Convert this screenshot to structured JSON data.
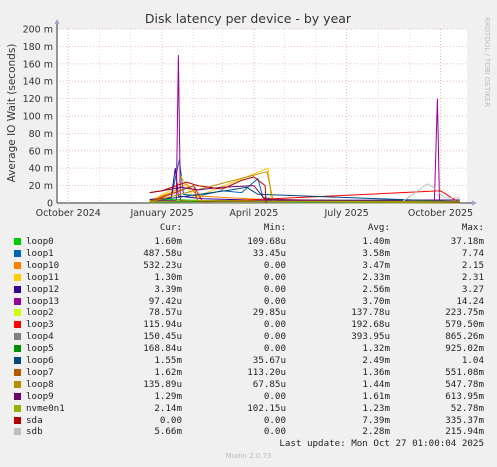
{
  "chart_data": {
    "type": "line",
    "title": "Disk latency per device - by year",
    "ylabel": "Average IO Wait (seconds)",
    "watermark": "RRDTOOL / TOBI OETIKER",
    "ylim": [
      0,
      0.2
    ],
    "y_ticks": [
      {
        "value": 0,
        "label": "0"
      },
      {
        "value": 0.02,
        "label": "20 m"
      },
      {
        "value": 0.04,
        "label": "40 m"
      },
      {
        "value": 0.06,
        "label": "60 m"
      },
      {
        "value": 0.08,
        "label": "80 m"
      },
      {
        "value": 0.1,
        "label": "100 m"
      },
      {
        "value": 0.12,
        "label": "120 m"
      },
      {
        "value": 0.14,
        "label": "140 m"
      },
      {
        "value": 0.16,
        "label": "160 m"
      },
      {
        "value": 0.18,
        "label": "180 m"
      },
      {
        "value": 0.2,
        "label": "200 m"
      }
    ],
    "xlim": [
      "2024-09-20",
      "2025-10-27"
    ],
    "x_ticks": [
      {
        "date": "2024-10-01",
        "label": "October 2024"
      },
      {
        "date": "2025-01-01",
        "label": "January 2025"
      },
      {
        "date": "2025-04-01",
        "label": "April 2025"
      },
      {
        "date": "2025-07-01",
        "label": "July 2025"
      },
      {
        "date": "2025-10-01",
        "label": "October 2025"
      }
    ],
    "legend_headers": {
      "cur": "Cur:",
      "min": "Min:",
      "avg": "Avg:",
      "max": "Max:"
    },
    "series": [
      {
        "name": "loop0",
        "color": "#00cc00",
        "cur": "1.60m",
        "min": "109.68u",
        "avg": "1.40m",
        "max": "37.18m",
        "points": [
          [
            "2024-12-20",
            0.002
          ],
          [
            "2025-01-10",
            0.004
          ],
          [
            "2025-02-05",
            0.003
          ],
          [
            "2025-03-01",
            0.002
          ],
          [
            "2025-04-10",
            0.002
          ],
          [
            "2025-05-01",
            0.002
          ],
          [
            "2025-07-01",
            0.001
          ],
          [
            "2025-10-20",
            0.0016
          ]
        ]
      },
      {
        "name": "loop1",
        "color": "#0066b3",
        "cur": "487.58u",
        "min": "33.45u",
        "avg": "3.58m",
        "max": "7.74",
        "points": [
          [
            "2024-12-20",
            0.004
          ],
          [
            "2025-01-10",
            0.006
          ],
          [
            "2025-01-18",
            0.05
          ],
          [
            "2025-01-22",
            0.01
          ],
          [
            "2025-02-05",
            0.008
          ],
          [
            "2025-03-01",
            0.014
          ],
          [
            "2025-03-20",
            0.012
          ],
          [
            "2025-04-05",
            0.028
          ],
          [
            "2025-04-10",
            0.006
          ],
          [
            "2025-05-15",
            0.002
          ],
          [
            "2025-10-20",
            0.0005
          ]
        ]
      },
      {
        "name": "loop10",
        "color": "#ff8000",
        "cur": "532.23u",
        "min": "0.00",
        "avg": "3.47m",
        "max": "2.15",
        "points": [
          [
            "2024-12-20",
            0.003
          ],
          [
            "2025-01-10",
            0.012
          ],
          [
            "2025-01-25",
            0.022
          ],
          [
            "2025-02-05",
            0.008
          ],
          [
            "2025-04-10",
            0.004
          ],
          [
            "2025-10-20",
            0.0005
          ]
        ]
      },
      {
        "name": "loop11",
        "color": "#ffcc00",
        "cur": "1.30m",
        "min": "0.00",
        "avg": "2.33m",
        "max": "2.31",
        "points": [
          [
            "2024-12-20",
            0.002
          ],
          [
            "2025-01-15",
            0.018
          ],
          [
            "2025-01-20",
            0.03
          ],
          [
            "2025-02-01",
            0.006
          ],
          [
            "2025-04-15",
            0.04
          ],
          [
            "2025-04-18",
            0.004
          ],
          [
            "2025-10-20",
            0.0013
          ]
        ]
      },
      {
        "name": "loop12",
        "color": "#330099",
        "cur": "3.39m",
        "min": "0.00",
        "avg": "2.56m",
        "max": "3.27",
        "points": [
          [
            "2024-12-20",
            0.004
          ],
          [
            "2025-01-10",
            0.006
          ],
          [
            "2025-01-14",
            0.04
          ],
          [
            "2025-01-17",
            0.008
          ],
          [
            "2025-02-10",
            0.005
          ],
          [
            "2025-04-10",
            0.003
          ],
          [
            "2025-10-20",
            0.0034
          ]
        ]
      },
      {
        "name": "loop13",
        "color": "#990099",
        "cur": "97.42u",
        "min": "0.00",
        "avg": "3.70m",
        "max": "14.24",
        "points": [
          [
            "2024-12-20",
            0.002
          ],
          [
            "2025-01-15",
            0.003
          ],
          [
            "2025-01-17",
            0.17
          ],
          [
            "2025-01-19",
            0.003
          ],
          [
            "2025-09-25",
            0.002
          ],
          [
            "2025-09-28",
            0.12
          ],
          [
            "2025-09-30",
            0.002
          ],
          [
            "2025-10-20",
            0.0001
          ]
        ]
      },
      {
        "name": "loop2",
        "color": "#ccff00",
        "cur": "78.57u",
        "min": "29.85u",
        "avg": "137.78u",
        "max": "223.75m",
        "points": [
          [
            "2024-12-20",
            0.0005
          ],
          [
            "2025-06-01",
            0.0003
          ],
          [
            "2025-10-20",
            0.0001
          ]
        ]
      },
      {
        "name": "loop3",
        "color": "#ff0000",
        "cur": "115.94u",
        "min": "0.00",
        "avg": "192.68u",
        "max": "579.50m",
        "points": [
          [
            "2024-12-20",
            0.001
          ],
          [
            "2025-02-01",
            0.02
          ],
          [
            "2025-02-10",
            0.001
          ],
          [
            "2025-10-01",
            0.014
          ],
          [
            "2025-10-20",
            0.0001
          ]
        ]
      },
      {
        "name": "loop4",
        "color": "#808080",
        "cur": "150.45u",
        "min": "0.00",
        "avg": "393.95u",
        "max": "865.26m",
        "points": [
          [
            "2024-12-20",
            0.0005
          ],
          [
            "2025-07-01",
            0.0004
          ],
          [
            "2025-10-20",
            0.00015
          ]
        ]
      },
      {
        "name": "loop5",
        "color": "#008f00",
        "cur": "168.84u",
        "min": "0.00",
        "avg": "1.32m",
        "max": "925.02m",
        "points": [
          [
            "2024-12-20",
            0.001
          ],
          [
            "2025-03-01",
            0.002
          ],
          [
            "2025-10-20",
            0.00017
          ]
        ]
      },
      {
        "name": "loop6",
        "color": "#00487d",
        "cur": "1.55m",
        "min": "35.67u",
        "avg": "2.49m",
        "max": "1.04",
        "points": [
          [
            "2024-12-20",
            0.002
          ],
          [
            "2025-03-10",
            0.015
          ],
          [
            "2025-03-25",
            0.018
          ],
          [
            "2025-04-05",
            0.01
          ],
          [
            "2025-10-20",
            0.0015
          ]
        ]
      },
      {
        "name": "loop7",
        "color": "#b35a00",
        "cur": "1.62m",
        "min": "113.20u",
        "avg": "1.36m",
        "max": "551.08m",
        "points": [
          [
            "2024-12-20",
            0.002
          ],
          [
            "2025-02-01",
            0.02
          ],
          [
            "2025-02-05",
            0.002
          ],
          [
            "2025-10-20",
            0.0016
          ]
        ]
      },
      {
        "name": "loop8",
        "color": "#b38f00",
        "cur": "135.89u",
        "min": "67.85u",
        "avg": "1.44m",
        "max": "547.78m",
        "points": [
          [
            "2024-12-20",
            0.001
          ],
          [
            "2025-04-14",
            0.036
          ],
          [
            "2025-04-20",
            0.002
          ],
          [
            "2025-10-20",
            0.00014
          ]
        ]
      },
      {
        "name": "loop9",
        "color": "#6b006b",
        "cur": "1.29m",
        "min": "0.00",
        "avg": "1.61m",
        "max": "613.95m",
        "points": [
          [
            "2024-12-20",
            0.012
          ],
          [
            "2025-01-01",
            0.014
          ],
          [
            "2025-01-20",
            0.018
          ],
          [
            "2025-02-05",
            0.015
          ],
          [
            "2025-03-01",
            0.018
          ],
          [
            "2025-04-01",
            0.02
          ],
          [
            "2025-04-12",
            0.004
          ],
          [
            "2025-10-20",
            0.0013
          ]
        ]
      },
      {
        "name": "nvme0n1",
        "color": "#8fb300",
        "cur": "2.14m",
        "min": "102.15u",
        "avg": "1.23m",
        "max": "52.78m",
        "points": [
          [
            "2024-12-20",
            0.001
          ],
          [
            "2025-02-01",
            0.003
          ],
          [
            "2025-05-01",
            0.002
          ],
          [
            "2025-08-01",
            0.002
          ],
          [
            "2025-10-20",
            0.0021
          ]
        ]
      },
      {
        "name": "sda",
        "color": "#b30000",
        "cur": "0.00",
        "min": "0.00",
        "avg": "7.39m",
        "max": "335.37m",
        "points": [
          [
            "2024-12-20",
            0.012
          ],
          [
            "2025-01-01",
            0.014
          ],
          [
            "2025-01-15",
            0.02
          ],
          [
            "2025-01-25",
            0.024
          ],
          [
            "2025-02-05",
            0.02
          ],
          [
            "2025-03-01",
            0.016
          ],
          [
            "2025-03-20",
            0.026
          ],
          [
            "2025-04-01",
            0.03
          ],
          [
            "2025-04-12",
            0.02
          ],
          [
            "2025-04-13",
            0.0
          ]
        ]
      },
      {
        "name": "sdb",
        "color": "#bebebe",
        "cur": "5.66m",
        "min": "0.00",
        "avg": "2.28m",
        "max": "215.94m",
        "points": [
          [
            "2025-08-25",
            0.002
          ],
          [
            "2025-09-10",
            0.015
          ],
          [
            "2025-09-18",
            0.022
          ],
          [
            "2025-09-24",
            0.018
          ],
          [
            "2025-10-05",
            0.006
          ],
          [
            "2025-10-20",
            0.0057
          ]
        ]
      }
    ],
    "last_update": "Last update:  Mon Oct 27 01:00:04 2025",
    "version": "Munin 2.0.73"
  }
}
